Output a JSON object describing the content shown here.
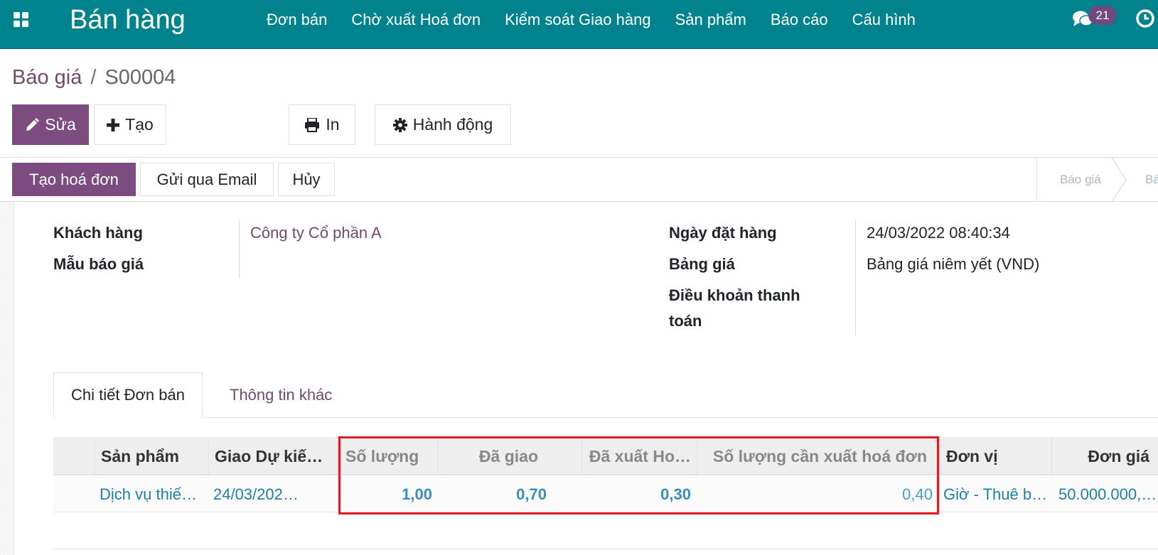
{
  "navbar": {
    "brand": "Bán hàng",
    "menu": [
      "Đơn bán",
      "Chờ xuất Hoá đơn",
      "Kiểm soát Giao hàng",
      "Sản phẩm",
      "Báo cáo",
      "Cấu hình"
    ],
    "chat_count": "21",
    "icons": [
      "apps-grid-icon",
      "chat-icon",
      "clock-icon"
    ]
  },
  "breadcrumb": {
    "parent": "Báo giá",
    "separator": "/",
    "current": "S00004"
  },
  "toolbar": {
    "edit_label": "Sửa",
    "create_label": "Tạo",
    "print_label": "In",
    "action_label": "Hành động"
  },
  "statusbar": {
    "create_invoice_label": "Tạo hoá đơn",
    "send_email_label": "Gửi qua Email",
    "cancel_label": "Hủy",
    "stages": [
      "Báo giá",
      "Bá"
    ]
  },
  "form": {
    "customer_label": "Khách hàng",
    "customer_value": "Công ty Cổ phần A",
    "template_label": "Mẫu báo giá",
    "order_date_label": "Ngày đặt hàng",
    "order_date_value": "24/03/2022 08:40:34",
    "pricelist_label": "Bảng giá",
    "pricelist_value": "Bảng giá niêm yết (VND)",
    "payment_terms_label_1": "Điều khoản thanh",
    "payment_terms_label_2": "toán"
  },
  "tabs": [
    {
      "label": "Chi tiết Đơn bán",
      "active": true
    },
    {
      "label": "Thông tin khác",
      "active": false
    }
  ],
  "table": {
    "headers": [
      "Sản phẩm",
      "Giao Dự kiế…",
      "Số lượng",
      "Đã giao",
      "Đã xuất Ho…",
      "Số lượng cần xuất hoá đơn",
      "Đơn vị",
      "Đơn giá"
    ],
    "rows": [
      [
        "Dịch vụ thiế…",
        "24/03/202…",
        "1,00",
        "0,70",
        "0,30",
        "0,40",
        "Giờ - Thuê b…",
        "50.000.000,…"
      ]
    ]
  },
  "colors": {
    "navbar": "#00838c",
    "primary": "#7c4b80",
    "link": "#714b67",
    "highlight": "#e01b24"
  }
}
